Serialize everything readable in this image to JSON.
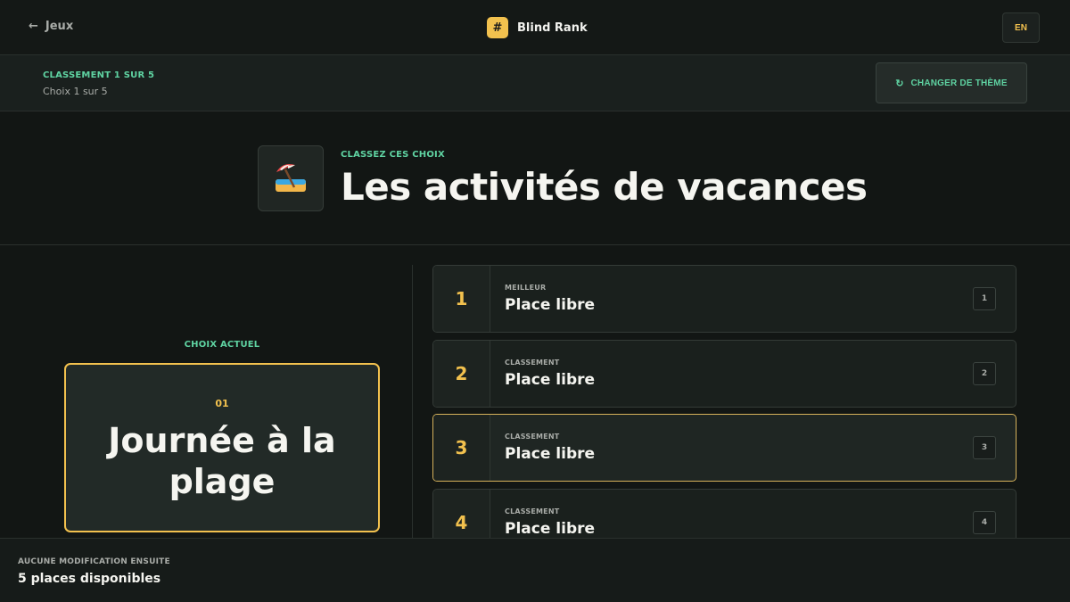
{
  "header": {
    "back_label": "Jeux",
    "brand_mark": "#",
    "brand_title": "Blind Rank",
    "language": "EN"
  },
  "progress": {
    "round_label": "CLASSEMENT 1 SUR 5",
    "choice_label": "Choix 1 sur 5",
    "change_theme_label": "CHANGER DE THÈME"
  },
  "theme": {
    "eyebrow": "CLASSEZ CES CHOIX",
    "title": "Les activités de vacances",
    "icon": "beach-umbrella-icon"
  },
  "current": {
    "label": "CHOIX ACTUEL",
    "number": "01",
    "name": "Journée à la plage"
  },
  "slots": [
    {
      "rank": "1",
      "kicker": "MEILLEUR",
      "title": "Place libre",
      "key": "1"
    },
    {
      "rank": "2",
      "kicker": "CLASSEMENT",
      "title": "Place libre",
      "key": "2"
    },
    {
      "rank": "3",
      "kicker": "CLASSEMENT",
      "title": "Place libre",
      "key": "3"
    },
    {
      "rank": "4",
      "kicker": "CLASSEMENT",
      "title": "Place libre",
      "key": "4"
    }
  ],
  "footer": {
    "kicker": "AUCUNE MODIFICATION ENSUITE",
    "status": "5 places disponibles"
  },
  "colors": {
    "background": "#121614",
    "accent_gold": "#f2c14e",
    "accent_green": "#5fd3a2"
  }
}
